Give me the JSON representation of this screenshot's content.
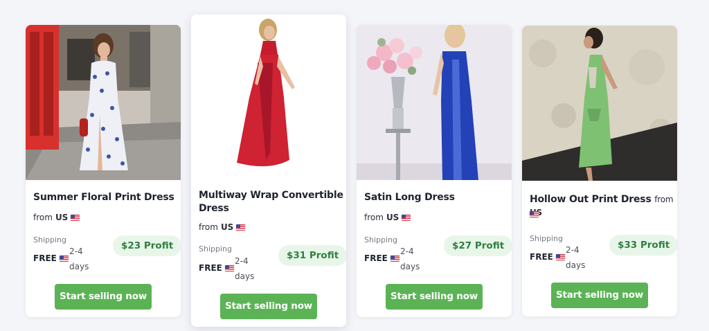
{
  "products": [
    {
      "title": "Summer Floral Print Dress",
      "from_label": "from",
      "origin": "US",
      "shipping_label": "Shipping",
      "shipping_value": "FREE",
      "days_range": "2-4",
      "days_unit": "days",
      "profit": "$23 Profit",
      "cta": "Start selling now",
      "image_alt": "Woman in white floral dress on city street"
    },
    {
      "title_line1": "Multiway Wrap Convertible",
      "title_line2": "Dress",
      "from_label": "from",
      "origin": "US",
      "shipping_label": "Shipping",
      "shipping_value": "FREE",
      "days_range": "2-4",
      "days_unit": "days",
      "profit": "$31 Profit",
      "cta": "Start selling now",
      "image_alt": "Model in red halter maxi dress"
    },
    {
      "title": "Satin Long Dress",
      "from_label": "from",
      "origin": "US",
      "shipping_label": "Shipping",
      "shipping_value": "FREE",
      "days_range": "2-4",
      "days_unit": "days",
      "profit": "$27 Profit",
      "cta": "Start selling now",
      "image_alt": "Model in blue satin dress beside flower vase"
    },
    {
      "title": "Hollow Out Print Dress",
      "from_label": "from",
      "origin": "US",
      "shipping_label": "Shipping",
      "shipping_value": "FREE",
      "days_range": "2-4",
      "days_unit": "days",
      "profit": "$33 Profit",
      "cta": "Start selling now",
      "image_alt": "Woman in green cutout dress against stone wall"
    }
  ],
  "icons": {
    "flag": "us-flag-icon"
  },
  "colors": {
    "background": "#f4f5f9",
    "card": "#ffffff",
    "cta": "#5bb355",
    "profit_bg": "#e8f6ea",
    "profit_text": "#2f7f3e"
  }
}
